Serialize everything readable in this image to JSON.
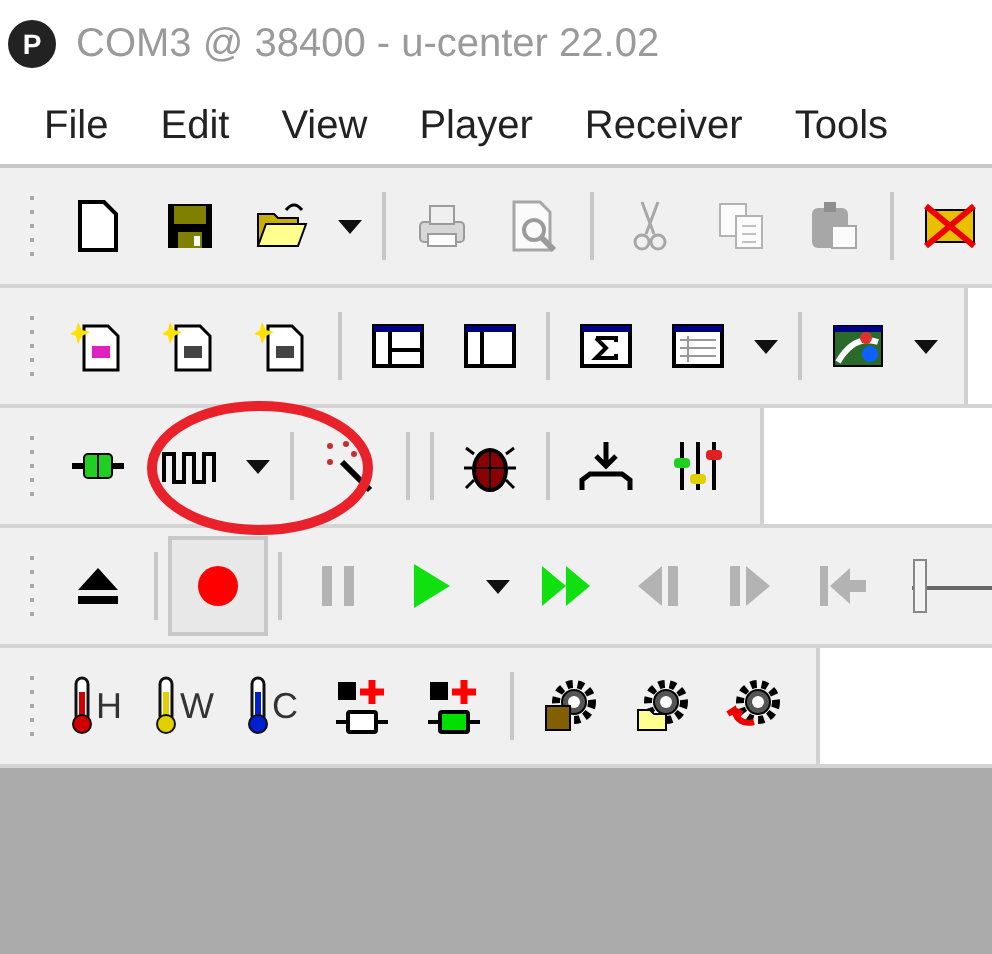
{
  "window": {
    "logo": "P",
    "title": "COM3 @ 38400 - u-center 22.02",
    "active": false
  },
  "menu": [
    "File",
    "Edit",
    "View",
    "Player",
    "Receiver",
    "Tools"
  ],
  "toolbars": [
    {
      "items": [
        {
          "kind": "new",
          "disabled": false,
          "pressed": false
        },
        {
          "kind": "save",
          "disabled": false,
          "pressed": false
        },
        {
          "kind": "open",
          "disabled": false,
          "pressed": false
        },
        {
          "kind": "dropdown",
          "disabled": false,
          "pressed": false
        },
        {
          "kind": "separator"
        },
        {
          "kind": "print",
          "disabled": true,
          "pressed": false
        },
        {
          "kind": "preview",
          "disabled": true,
          "pressed": false
        },
        {
          "kind": "separator"
        },
        {
          "kind": "cut",
          "disabled": true,
          "pressed": false
        },
        {
          "kind": "copy",
          "disabled": true,
          "pressed": false
        },
        {
          "kind": "paste",
          "disabled": true,
          "pressed": false
        },
        {
          "kind": "separator"
        },
        {
          "kind": "erase",
          "disabled": false,
          "pressed": false
        }
      ]
    },
    {
      "items": [
        {
          "kind": "sparkle-doc",
          "disabled": false,
          "pressed": false
        },
        {
          "kind": "sparkle-doc",
          "disabled": false,
          "pressed": false
        },
        {
          "kind": "sparkle-doc",
          "disabled": false,
          "pressed": false
        },
        {
          "kind": "separator"
        },
        {
          "kind": "split-view",
          "disabled": false,
          "pressed": false
        },
        {
          "kind": "panel-view",
          "disabled": false,
          "pressed": false
        },
        {
          "kind": "separator"
        },
        {
          "kind": "sigma",
          "disabled": false,
          "pressed": false
        },
        {
          "kind": "table",
          "disabled": false,
          "pressed": false
        },
        {
          "kind": "dropdown",
          "disabled": false,
          "pressed": false
        },
        {
          "kind": "separator"
        },
        {
          "kind": "chart",
          "disabled": false,
          "pressed": false
        },
        {
          "kind": "dropdown",
          "disabled": false,
          "pressed": false
        }
      ]
    },
    {
      "items": [
        {
          "kind": "plug",
          "disabled": false,
          "pressed": false
        },
        {
          "kind": "wave",
          "disabled": false,
          "pressed": false
        },
        {
          "kind": "dropdown",
          "disabled": false,
          "pressed": false
        },
        {
          "kind": "separator"
        },
        {
          "kind": "wand",
          "disabled": false,
          "pressed": false
        },
        {
          "kind": "separator"
        },
        {
          "kind": "separator"
        },
        {
          "kind": "bug",
          "disabled": false,
          "pressed": false
        },
        {
          "kind": "separator"
        },
        {
          "kind": "download",
          "disabled": false,
          "pressed": false
        },
        {
          "kind": "mixer",
          "disabled": false,
          "pressed": false
        }
      ]
    },
    {
      "items": [
        {
          "kind": "eject",
          "disabled": false,
          "pressed": false
        },
        {
          "kind": "separator"
        },
        {
          "kind": "record",
          "disabled": false,
          "pressed": true
        },
        {
          "kind": "separator"
        },
        {
          "kind": "pause",
          "disabled": true,
          "pressed": false
        },
        {
          "kind": "play",
          "disabled": false,
          "pressed": false
        },
        {
          "kind": "dropdown",
          "disabled": false,
          "pressed": false
        },
        {
          "kind": "fast-forward",
          "disabled": false,
          "pressed": false
        },
        {
          "kind": "step-back",
          "disabled": true,
          "pressed": false
        },
        {
          "kind": "step-forward",
          "disabled": true,
          "pressed": false
        },
        {
          "kind": "to-start",
          "disabled": true,
          "pressed": false
        },
        {
          "kind": "slider",
          "level": 0
        }
      ]
    },
    {
      "items": [
        {
          "kind": "thermometer",
          "label": "H",
          "color": "#d00000",
          "disabled": false,
          "pressed": false
        },
        {
          "kind": "thermometer",
          "label": "W",
          "color": "#e0d000",
          "disabled": false,
          "pressed": false
        },
        {
          "kind": "thermometer",
          "label": "C",
          "color": "#0020d0",
          "disabled": false,
          "pressed": false
        },
        {
          "kind": "memory",
          "color": "#ffffff",
          "disabled": false,
          "pressed": false
        },
        {
          "kind": "memory",
          "color": "#00e000",
          "disabled": false,
          "pressed": false
        },
        {
          "kind": "separator"
        },
        {
          "kind": "gear-save",
          "disabled": false,
          "pressed": false
        },
        {
          "kind": "gear-open",
          "disabled": false,
          "pressed": false
        },
        {
          "kind": "gear-revert",
          "disabled": false,
          "pressed": false
        }
      ]
    }
  ],
  "annotations": [
    {
      "kind": "ellipse"
    }
  ]
}
